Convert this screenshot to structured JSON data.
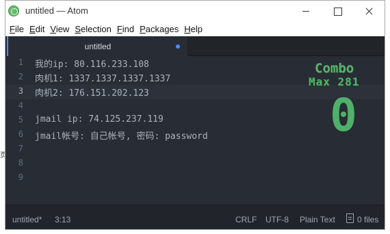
{
  "window": {
    "title": "untitled — Atom",
    "icon": "atom-icon"
  },
  "menu": [
    {
      "u": "F",
      "rest": "ile"
    },
    {
      "u": "E",
      "rest": "dit"
    },
    {
      "u": "V",
      "rest": "iew"
    },
    {
      "u": "S",
      "rest": "election"
    },
    {
      "u": "F",
      "rest": "ind"
    },
    {
      "u": "P",
      "rest": "ackages"
    },
    {
      "u": "H",
      "rest": "elp"
    }
  ],
  "tab": {
    "title": "untitled",
    "modified": true
  },
  "editor": {
    "line_numbers": [
      "1",
      "2",
      "3",
      "4",
      "5",
      "6",
      "7",
      "8",
      "9"
    ],
    "active_line": 3,
    "lines": [
      "我的ip: 80.116.233.108",
      "肉机1: 1337.1337.1337.1337",
      "肉机2: 176.151.202.123",
      "",
      "jmail ip: 74.125.237.119",
      "jmail帐号: 自己帐号, 密码: password",
      "",
      "",
      ""
    ]
  },
  "combo": {
    "title": "Combo",
    "max_label": "Max 281",
    "count": "0"
  },
  "status": {
    "file": "untitled*",
    "cursor": "3:13",
    "line_ending": "CRLF",
    "encoding": "UTF-8",
    "grammar": "Plain Text",
    "files": "0 files"
  },
  "edge_char": "页",
  "colors": {
    "editor_bg": "#282c34",
    "accent": "#528bff",
    "combo_green": "#4fb06a"
  }
}
